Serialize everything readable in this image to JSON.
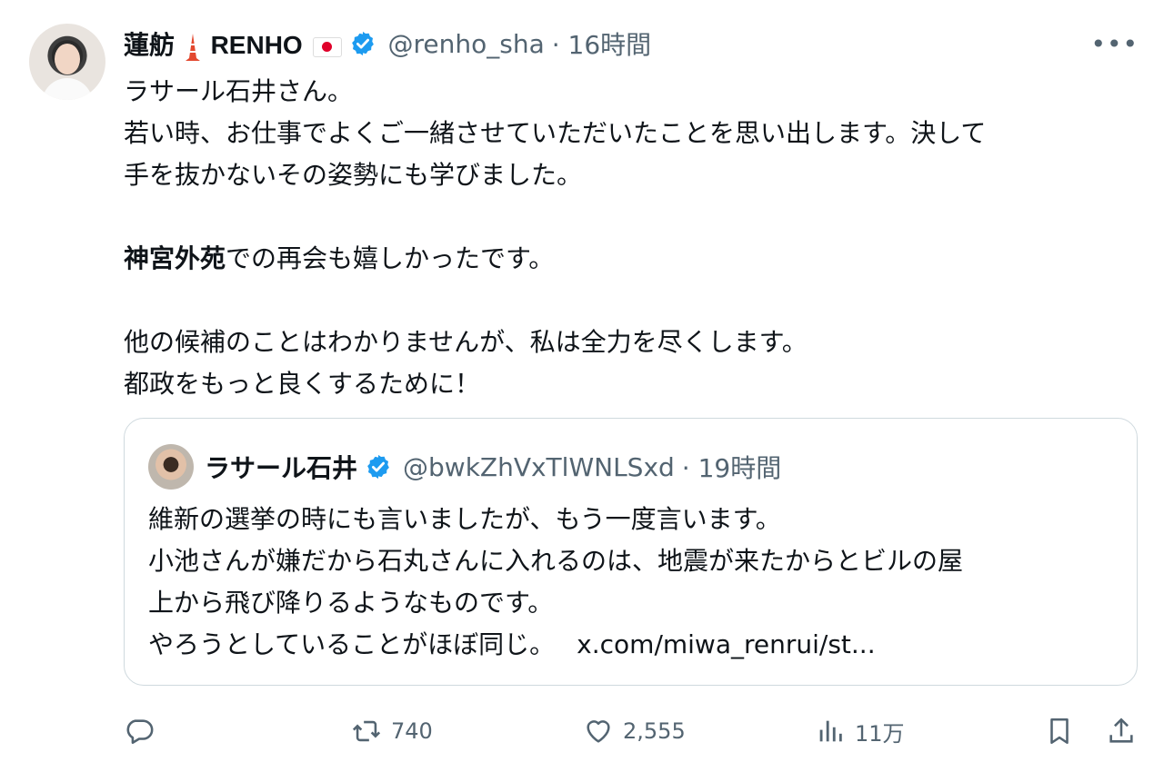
{
  "author": {
    "display_name": "蓮舫",
    "display_name_latin": "RENHO",
    "handle": "@renho_sha",
    "time": "· 16時間"
  },
  "tweet": {
    "lines": [
      "ラサール石井さん。",
      "若い時、お仕事でよくご一緒させていただいたことを思い出します。決して",
      "手を抜かないその姿勢にも学びました。",
      "",
      "での再会も嬉しかったです。",
      "",
      "他の候補のことはわかりませんが、私は全力を尽くします。",
      "都政をもっと良くするために！"
    ],
    "bold_prefix": "神宮外苑"
  },
  "quote": {
    "display_name": "ラサール石井",
    "handle": "@bwkZhVxTlWNLSxd",
    "time": "· 19時間",
    "lines": [
      "維新の選挙の時にも言いましたが、もう一度言います。",
      "小池さんが嫌だから石丸さんに入れるのは、地震が来たからとビルの屋",
      "上から飛び降りるようなものです。",
      "やろうとしていることがほぼ同じ。"
    ],
    "link": "x.com/miwa_renrui/st..."
  },
  "actions": {
    "reply_count": "",
    "retweet_count": "740",
    "like_count": "2,555",
    "views_count": "11万"
  },
  "colors": {
    "verified": "#1d9bf0",
    "muted": "#536471",
    "border": "#cfd9de"
  }
}
